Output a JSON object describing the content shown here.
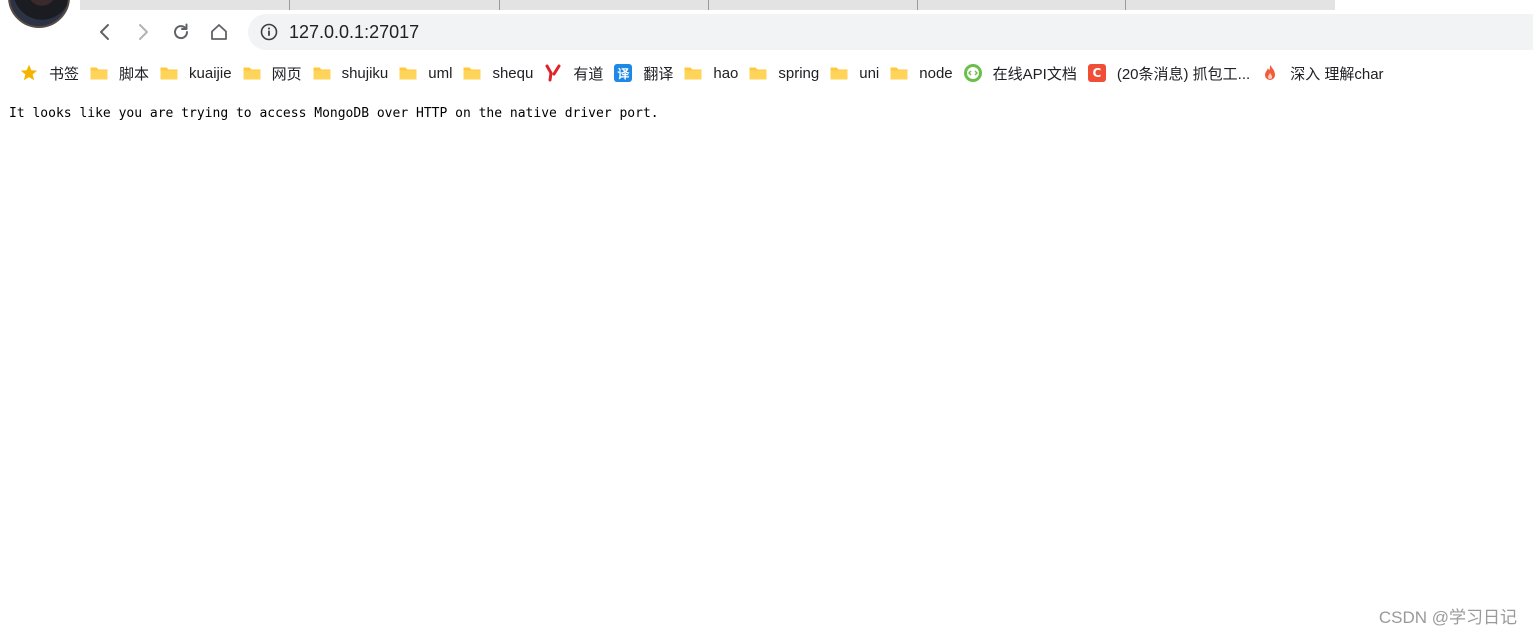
{
  "toolbar": {
    "url": "127.0.0.1:27017"
  },
  "bookmarks": [
    {
      "label": "书签",
      "icon": "star-icon"
    },
    {
      "label": "脚本",
      "icon": "folder-icon"
    },
    {
      "label": "kuaijie",
      "icon": "folder-icon"
    },
    {
      "label": "网页",
      "icon": "folder-icon"
    },
    {
      "label": "shujiku",
      "icon": "folder-icon"
    },
    {
      "label": "uml",
      "icon": "folder-icon"
    },
    {
      "label": "shequ",
      "icon": "folder-icon"
    },
    {
      "label": "有道",
      "icon": "youdao-icon"
    },
    {
      "label": "翻译",
      "icon": "translate-icon",
      "badge_text": "译"
    },
    {
      "label": "hao",
      "icon": "folder-icon"
    },
    {
      "label": "spring",
      "icon": "folder-icon"
    },
    {
      "label": "uni",
      "icon": "folder-icon"
    },
    {
      "label": "node",
      "icon": "folder-icon"
    },
    {
      "label": "在线API文档",
      "icon": "api-doc-icon"
    },
    {
      "label": "(20条消息) 抓包工...",
      "icon": "csdn-icon",
      "badge_text": "C"
    },
    {
      "label": "深入 理解char",
      "icon": "flame-icon"
    }
  ],
  "page": {
    "message": "It looks like you are trying to access MongoDB over HTTP on the native driver port."
  },
  "watermark": "CSDN @学习日记",
  "colors": {
    "folder": "#ffc83d",
    "star": "#f5b400",
    "youdao": "#e0232a",
    "translate": "#1e88e5",
    "csdn": "#f04e37",
    "api": "#6abf4b"
  }
}
